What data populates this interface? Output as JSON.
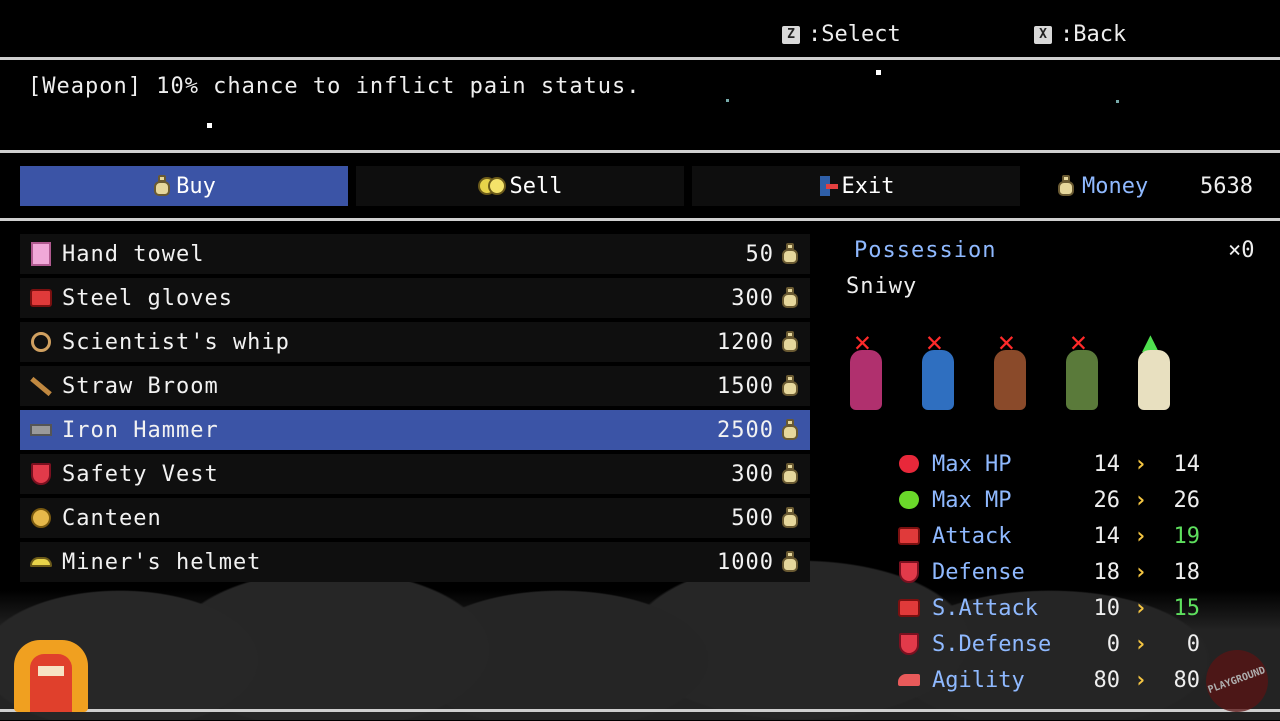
{
  "hints": [
    {
      "key": "Z",
      "label": ":Select"
    },
    {
      "key": "X",
      "label": ":Back"
    }
  ],
  "description": "[Weapon] 10% chance to inflict pain status.",
  "tabs": [
    {
      "label": "Buy",
      "icon": "money-bag-icon",
      "active": true
    },
    {
      "label": "Sell",
      "icon": "coins-icon",
      "active": false
    },
    {
      "label": "Exit",
      "icon": "exit-door-icon",
      "active": false
    }
  ],
  "money": {
    "label": "Money",
    "value": "5638",
    "icon": "money-bag-icon"
  },
  "items": [
    {
      "name": "Hand towel",
      "price": "50",
      "icon": "towel-icon"
    },
    {
      "name": "Steel gloves",
      "price": "300",
      "icon": "gloves-icon"
    },
    {
      "name": "Scientist's whip",
      "price": "1200",
      "icon": "whip-icon"
    },
    {
      "name": "Straw Broom",
      "price": "1500",
      "icon": "broom-icon"
    },
    {
      "name": "Iron Hammer",
      "price": "2500",
      "icon": "hammer-icon",
      "selected": true
    },
    {
      "name": "Safety Vest",
      "price": "300",
      "icon": "vest-icon"
    },
    {
      "name": "Canteen",
      "price": "500",
      "icon": "canteen-icon"
    },
    {
      "name": "Miner's helmet",
      "price": "1000",
      "icon": "helmet-icon"
    }
  ],
  "possession": {
    "label": "Possession",
    "count": "×0"
  },
  "character": {
    "name": "Sniwy"
  },
  "party": [
    {
      "mark": "cannot-equip",
      "color": "#b0306e"
    },
    {
      "mark": "cannot-equip",
      "color": "#2f6fc0"
    },
    {
      "mark": "cannot-equip",
      "color": "#8a4a2a"
    },
    {
      "mark": "cannot-equip",
      "color": "#5a7a3a"
    },
    {
      "mark": "stat-up",
      "color": "#e8e0c0"
    }
  ],
  "stats": [
    {
      "label": "Max HP",
      "current": "14",
      "next": "14",
      "icon": "heart-icon",
      "up": false
    },
    {
      "label": "Max MP",
      "current": "26",
      "next": "26",
      "icon": "green-heart-icon",
      "up": false
    },
    {
      "label": "Attack",
      "current": "14",
      "next": "19",
      "icon": "fist-icon",
      "up": true
    },
    {
      "label": "Defense",
      "current": "18",
      "next": "18",
      "icon": "shield-icon",
      "up": false
    },
    {
      "label": "S.Attack",
      "current": "10",
      "next": "15",
      "icon": "fist-icon",
      "up": true
    },
    {
      "label": "S.Defense",
      "current": "0",
      "next": "0",
      "icon": "shield-icon",
      "up": false
    },
    {
      "label": "Agility",
      "current": "80",
      "next": "80",
      "icon": "shoe-icon",
      "up": false
    }
  ],
  "colors": {
    "accent": "#3b54a6",
    "label_blue": "#8fb9ff",
    "stat_up": "#5ee05e",
    "arrow": "#f4c542"
  },
  "watermark": "PLAYGROUND"
}
